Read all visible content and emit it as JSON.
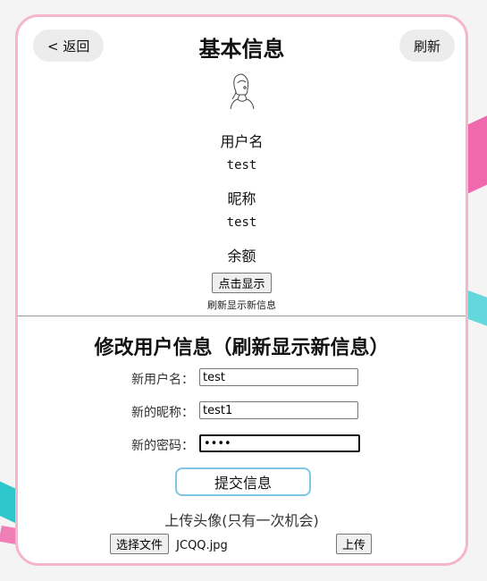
{
  "header": {
    "back_label": "< 返回",
    "title": "基本信息",
    "refresh_label": "刷新"
  },
  "profile": {
    "username_label": "用户名",
    "username_value": "test",
    "nickname_label": "昵称",
    "nickname_value": "test",
    "balance_label": "余额",
    "show_button": "点击显示",
    "refresh_hint": "刷新显示新信息"
  },
  "edit": {
    "title": "修改用户信息（刷新显示新信息）",
    "new_username_label": "新用户名：",
    "new_username_value": "test",
    "new_nickname_label": "新的昵称：",
    "new_nickname_value": "test1",
    "new_password_label": "新的密码：",
    "new_password_value": "1234",
    "submit_label": "提交信息"
  },
  "upload": {
    "title": "上传头像(只有一次机会)",
    "choose_file_label": "选择文件",
    "file_name": "JCQQ.jpg",
    "upload_label": "上传"
  },
  "colors": {
    "card_border": "#f5b6c8",
    "submit_border": "#7dc6e6",
    "pill_bg": "#ececec"
  }
}
